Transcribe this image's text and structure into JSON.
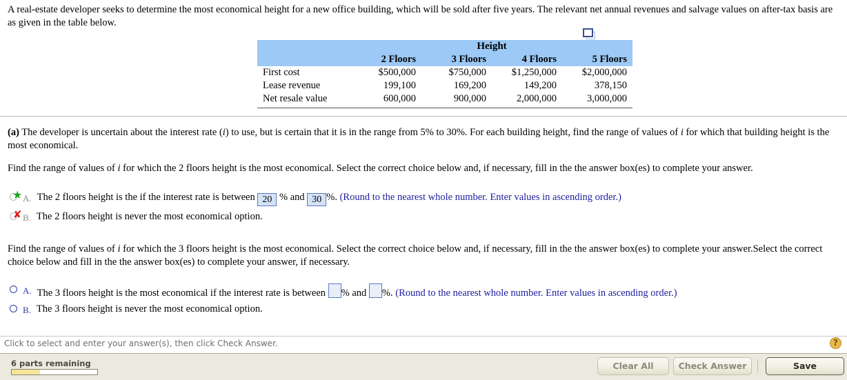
{
  "intro": {
    "text": "A real-estate developer seeks to determine the most economical height for a new office building, which will be sold after five years. The relevant net annual revenues and salvage values on after-tax basis are as given in the table below."
  },
  "table": {
    "group_header": "Height",
    "columns": [
      "2 Floors",
      "3 Floors",
      "4 Floors",
      "5 Floors"
    ],
    "rows": [
      {
        "label": "First cost",
        "values": [
          "$500,000",
          "$750,000",
          "$1,250,000",
          "$2,000,000"
        ]
      },
      {
        "label": "Lease revenue",
        "values": [
          "199,100",
          "169,200",
          "149,200",
          "378,150"
        ]
      },
      {
        "label": "Net resale value",
        "values": [
          "600,000",
          "900,000",
          "2,000,000",
          "3,000,000"
        ]
      }
    ],
    "copy_icon": "copy-window-icon"
  },
  "part_a": {
    "prompt_prefix": "(a)",
    "prompt_body": " The developer is uncertain about the interest rate (",
    "prompt_var": "i",
    "prompt_body2": ") to use, but is certain that it is in the range from 5% to 30%. For each building height, find the range of values of ",
    "prompt_var2": "i",
    "prompt_body3": " for which that building height is the most economical."
  },
  "question1": {
    "prompt_p1": "Find the range of values of ",
    "prompt_var": "i",
    "prompt_p2": " for which the 2 floors height is the most economical. Select the correct choice below and, if necessary, fill in the the answer box(es) to complete your answer.",
    "choices": [
      {
        "letter": "A.",
        "state": "correct",
        "mark": "★",
        "text_before": "The 2 floors height is the if the interest rate is between",
        "value1": "20",
        "mid": "% and",
        "value2": "30",
        "after": "%.",
        "hint": "(Round to the nearest whole number. Enter values in ascending order.)"
      },
      {
        "letter": "B.",
        "state": "incorrect",
        "mark": "✘",
        "text_before": "The 2 floors height is never the most economical option.",
        "value1": null,
        "mid": null,
        "value2": null,
        "after": null,
        "hint": null
      }
    ]
  },
  "question2": {
    "prompt_p1": "Find the range of values of ",
    "prompt_var": "i",
    "prompt_p2": " for which the 3 floors height is the most economical. Select the correct choice below and, if necessary, fill in the the answer box(es) to complete your answer.Select the correct choice below and fill in the the answer box(es) to complete your answer, if necessary.",
    "choices": [
      {
        "letter": "A.",
        "state": "unselected",
        "mark": "",
        "text_before": "The 3 floors height is the most economical if the interest rate is between",
        "value1": "",
        "mid": "% and",
        "value2": "",
        "after": "%.",
        "hint": "(Round to the nearest whole number. Enter values in ascending order.)"
      },
      {
        "letter": "B.",
        "state": "unselected",
        "mark": "",
        "text_before": "The 3 floors height is never the most economical option.",
        "value1": null,
        "mid": null,
        "value2": null,
        "after": null,
        "hint": null
      }
    ]
  },
  "status": {
    "message": "Click to select and enter your answer(s), then click Check Answer.",
    "help_icon": "question-mark-icon"
  },
  "toolbar": {
    "parts_remaining": "6 parts remaining",
    "progress_percent": "33%",
    "clear_all": "Clear All",
    "check_answer": "Check Answer",
    "save": "Save"
  },
  "colors": {
    "table_header": "#9cc9f5",
    "hint_text": "#1d1d9e",
    "correct_mark": "#1aa81a",
    "incorrect_mark": "#e01b1b",
    "progress_fill": "#f5e49a",
    "toolbar_bg": "#eceade",
    "help_icon": "#e8b84b"
  }
}
